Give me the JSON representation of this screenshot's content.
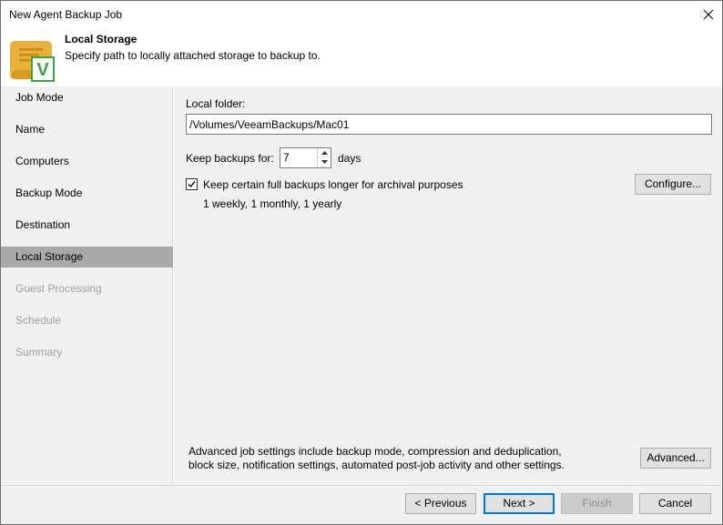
{
  "window": {
    "title": "New Agent Backup Job"
  },
  "header": {
    "title": "Local Storage",
    "subtitle": "Specify path to locally attached storage to backup to.",
    "logo_letter": "V"
  },
  "sidebar": {
    "items": [
      {
        "label": "Job Mode",
        "state": "normal"
      },
      {
        "label": "Name",
        "state": "normal"
      },
      {
        "label": "Computers",
        "state": "normal"
      },
      {
        "label": "Backup Mode",
        "state": "normal"
      },
      {
        "label": "Destination",
        "state": "normal"
      },
      {
        "label": "Local Storage",
        "state": "active"
      },
      {
        "label": "Guest Processing",
        "state": "disabled"
      },
      {
        "label": "Schedule",
        "state": "disabled"
      },
      {
        "label": "Summary",
        "state": "disabled"
      }
    ]
  },
  "form": {
    "local_folder_label": "Local folder:",
    "local_folder_value": "/Volumes/VeeamBackups/Mac01",
    "keep_backups_label": "Keep backups for:",
    "keep_backups_value": "7",
    "keep_backups_unit": "days",
    "archive_checkbox_label": "Keep certain full backups longer for archival purposes",
    "archive_checked": true,
    "archive_summary": "1 weekly, 1 monthly, 1 yearly",
    "configure_label": "Configure...",
    "advanced_text_line1": "Advanced job settings include backup mode, compression and deduplication,",
    "advanced_text_line2": "block size, notification settings, automated post-job activity and other settings.",
    "advanced_label": "Advanced..."
  },
  "footer": {
    "previous_label": "< Previous",
    "next_label": "Next >",
    "finish_label": "Finish",
    "cancel_label": "Cancel"
  },
  "colors": {
    "logo_yellow": "#e8b13c",
    "logo_green": "#3ba63b",
    "active_nav": "#a9a9a9",
    "panel_bg": "#f0f0f0"
  }
}
